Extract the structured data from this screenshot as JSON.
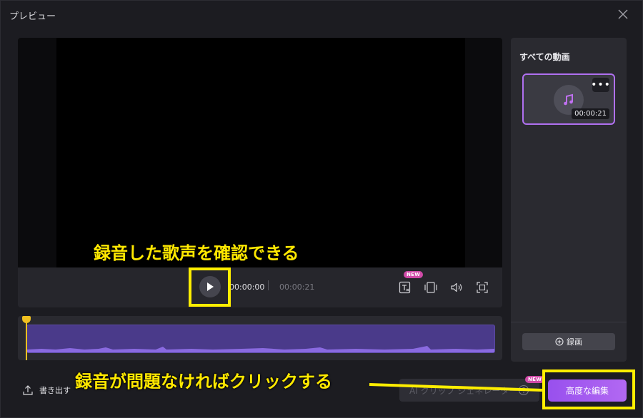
{
  "window": {
    "title": "プレビュー"
  },
  "player": {
    "current_time": "00:00:00",
    "total_time": "00:00:21",
    "new_badge": "NEW"
  },
  "sidebar": {
    "title": "すべての動画",
    "items": [
      {
        "duration": "00:00:21",
        "more": "•••",
        "icon": "music-note-icon"
      }
    ],
    "record_label": "録画"
  },
  "footer": {
    "export_label": "書き出す",
    "ai_button_label": "AI クリップ ジェネレーター",
    "ai_new_badge": "NEW",
    "advanced_edit_label": "高度な編集"
  },
  "annotations": {
    "caption_top": "録音した歌声を確認できる",
    "caption_bottom": "録音が問題なければクリックする"
  },
  "colors": {
    "accent": "#a45cf0",
    "highlight": "#ffee00",
    "waveform": "#4a3a8a",
    "playhead": "#f0c020"
  }
}
